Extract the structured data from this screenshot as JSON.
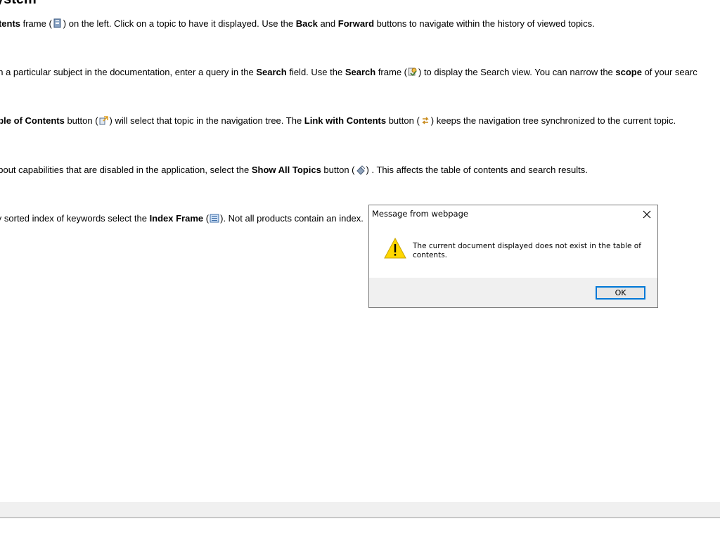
{
  "help": {
    "heading": "ystem",
    "p1": {
      "a": "ntents",
      "b": " frame (",
      "c": ") on the left. Click on a topic to have it displayed. Use the ",
      "d": "Back",
      "e": " and ",
      "f": "Forward",
      "g": " buttons to navigate within the history of viewed topics."
    },
    "p2": {
      "a": "on a particular subject in the documentation, enter a query in the ",
      "b": "Search",
      "c": " field. Use the ",
      "d": "Search",
      "e": " frame (",
      "f": ") to display the Search view. You can narrow the ",
      "g": "scope",
      "h": " of your searc"
    },
    "p3": {
      "a": "able of Contents",
      "b": " button (",
      "c": ") will select that topic in the navigation tree. The ",
      "d": "Link with Contents",
      "e": " button (",
      "f": ") keeps the navigation tree synchronized to the current topic."
    },
    "p4": {
      "a": "about capabilities that are disabled in the application, select the ",
      "b": "Show All Topics",
      "c": " button (",
      "d": ") . This affects the table of contents and search results."
    },
    "p5": {
      "a": "lly sorted index of keywords select the ",
      "b": "Index Frame",
      "c": " (",
      "d": "). Not all products contain an index."
    }
  },
  "dialog": {
    "title": "Message from webpage",
    "message": "The current document displayed does not exist in the table of contents.",
    "ok_label": "OK"
  },
  "icons": {
    "contents_frame": "contents-frame-icon",
    "search_frame": "search-frame-icon",
    "show_in_toc": "show-in-toc-icon",
    "link_with_contents": "link-with-contents-icon",
    "show_all_topics": "show-all-topics-icon",
    "index_frame": "index-frame-icon",
    "warning": "warning-icon",
    "close": "close-icon"
  },
  "colors": {
    "warning_fill": "#ffd700",
    "focus_border": "#0078d7"
  }
}
